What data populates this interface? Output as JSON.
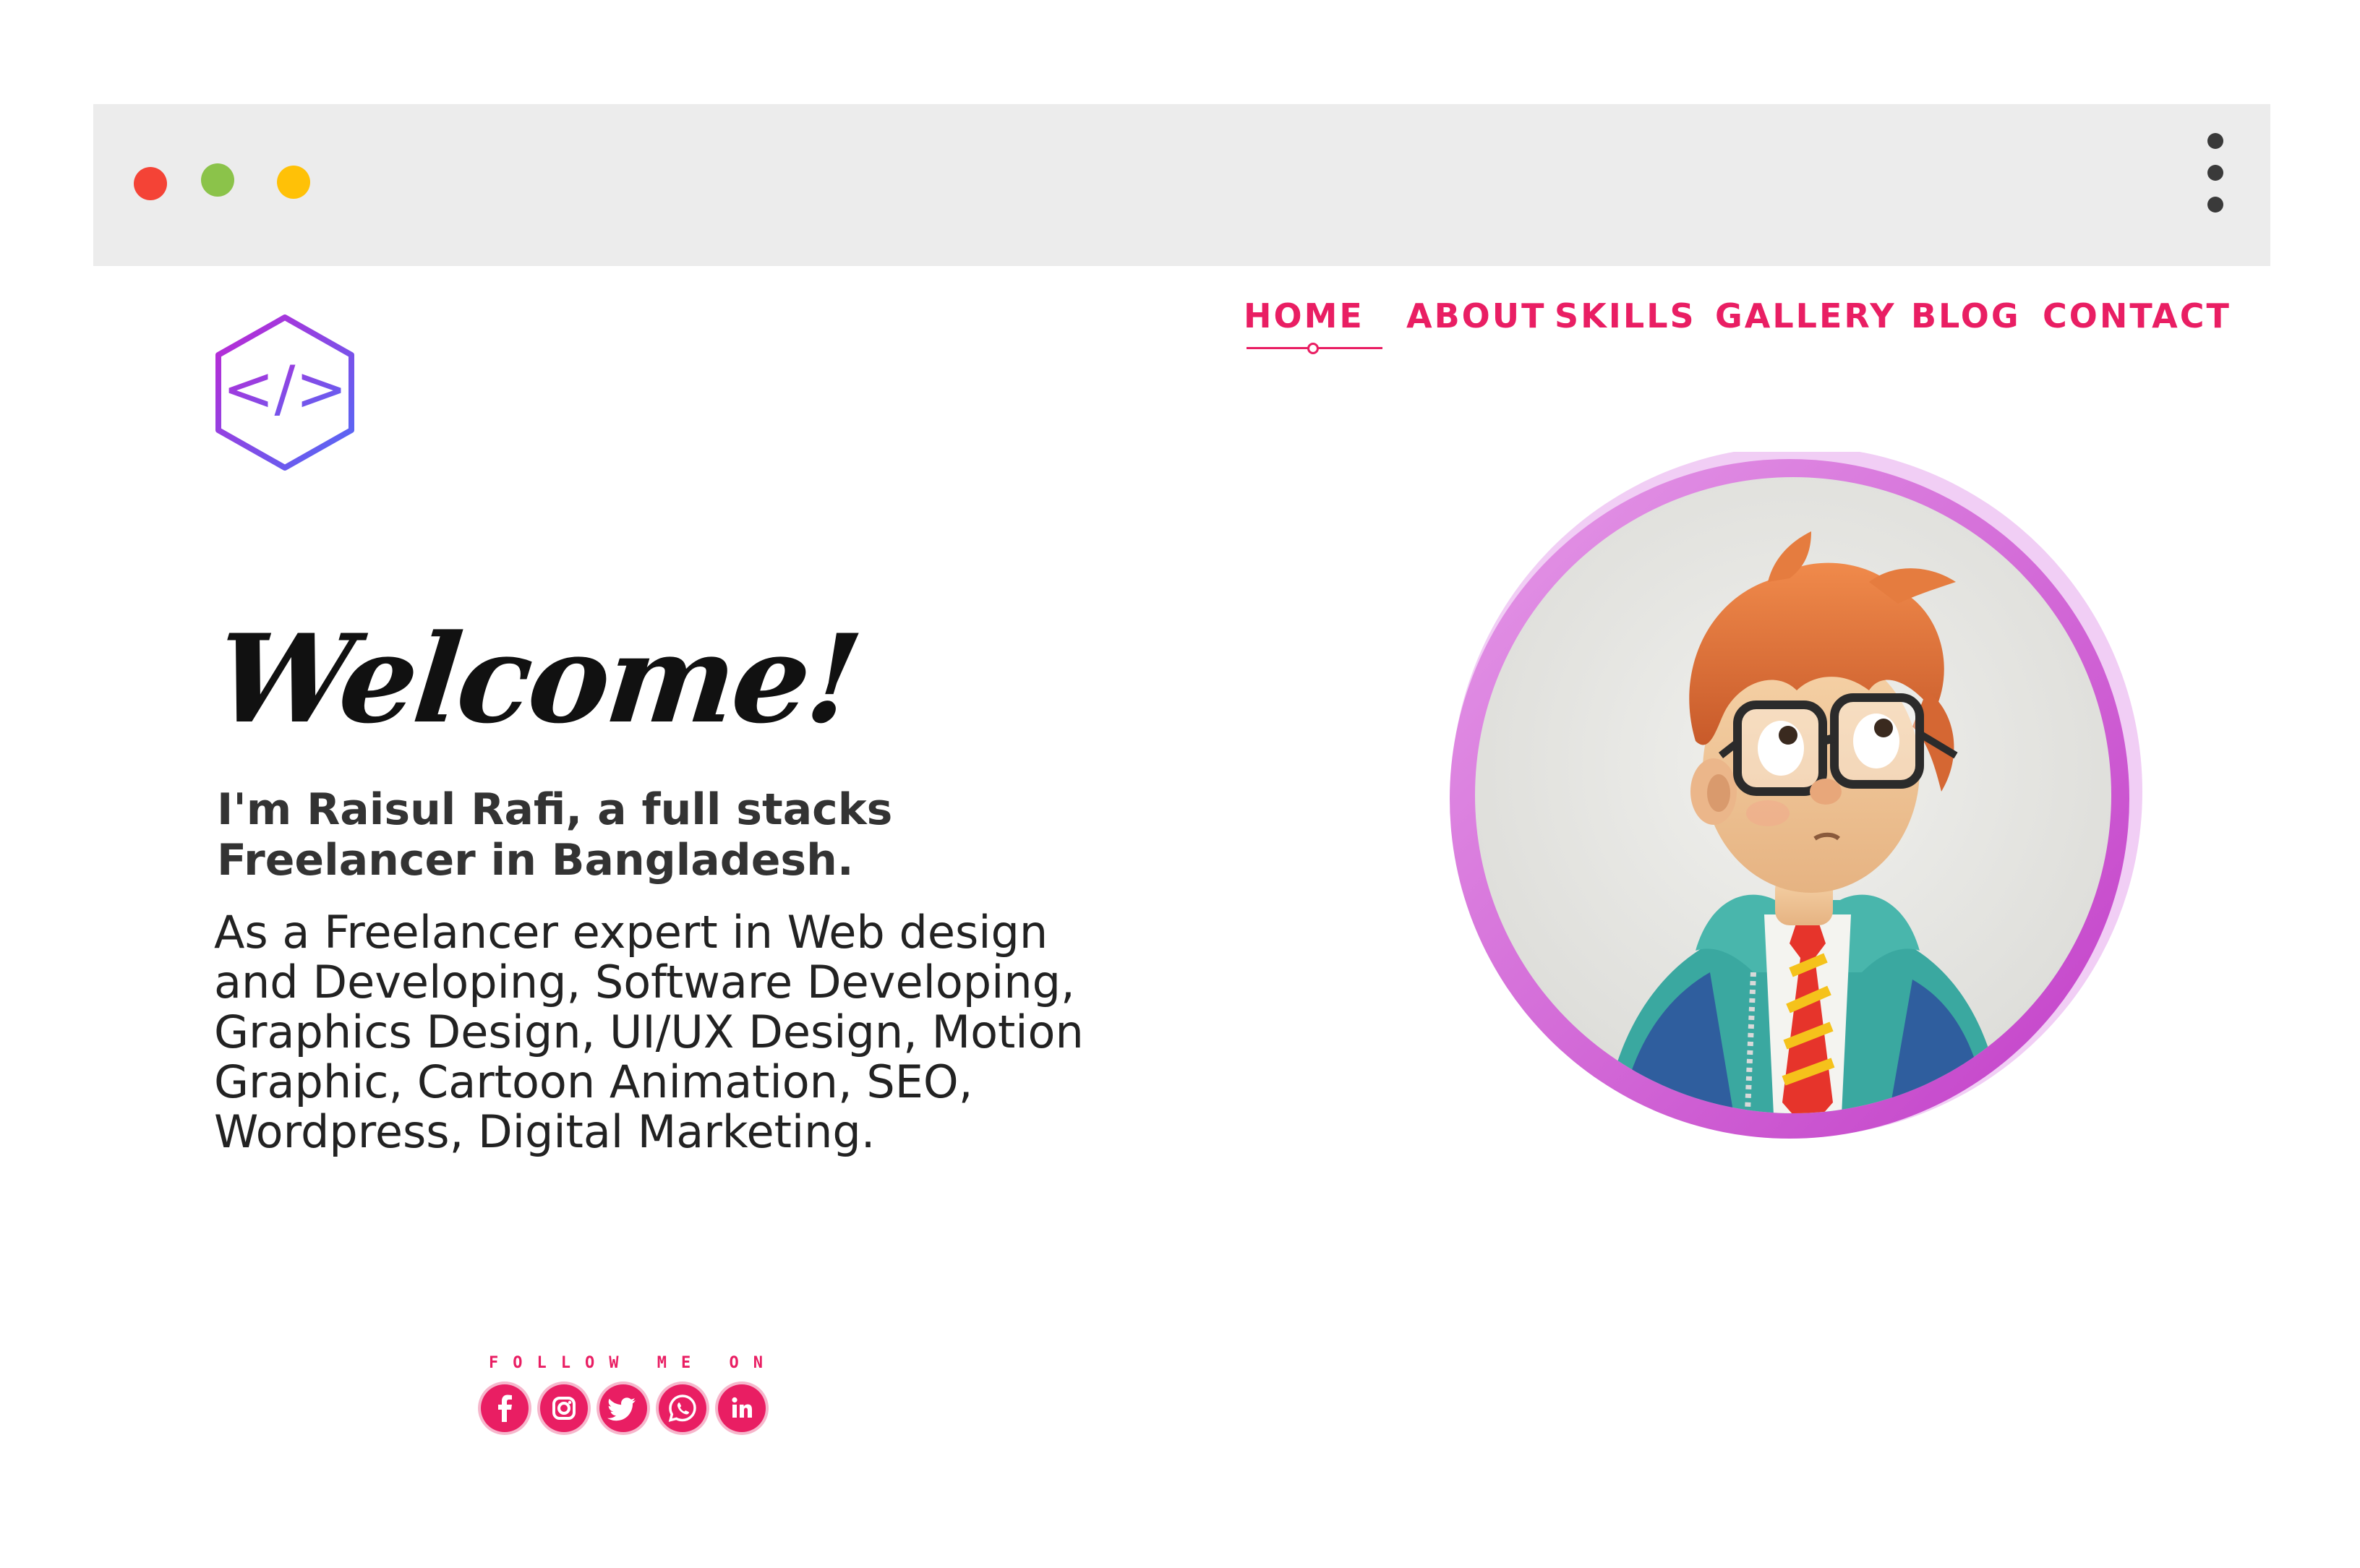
{
  "browser": {
    "window_controls": [
      "close-dot",
      "minimize-dot",
      "maximize-dot"
    ],
    "menu_icon": "kebab-menu-icon"
  },
  "logo": {
    "icon": "code-hexagon-icon",
    "text": "</>"
  },
  "nav": {
    "items": [
      {
        "label": "HOME",
        "active": true
      },
      {
        "label": "ABOUT",
        "active": false
      },
      {
        "label": "SKILLS",
        "active": false
      },
      {
        "label": "GALLERY",
        "active": false
      },
      {
        "label": "BLOG",
        "active": false
      },
      {
        "label": "CONTACT",
        "active": false
      }
    ]
  },
  "hero": {
    "welcome": "Welcome!",
    "intro_line1": "I'm Raisul Rafi, a full stacks",
    "intro_line2": "Freelancer in Bangladesh.",
    "description_lines": [
      "As a Freelancer expert in Web design",
      "and Developing, Software Developing,",
      "Graphics Design, UI/UX Design, Motion",
      "Graphic, Cartoon Animation, SEO,",
      "Wordpress, Digital Marketing."
    ]
  },
  "follow": {
    "label": "FOLLOW ME ON",
    "socials": [
      {
        "name": "facebook-icon"
      },
      {
        "name": "instagram-icon"
      },
      {
        "name": "twitter-icon"
      },
      {
        "name": "whatsapp-icon"
      },
      {
        "name": "linkedin-icon"
      }
    ]
  },
  "colors": {
    "accent": "#e91e63",
    "chrome": "#ececec",
    "avatar_ring": "#cf4fd0",
    "logo_gradient_start": "#c026d3",
    "logo_gradient_end": "#4f6cf7"
  }
}
